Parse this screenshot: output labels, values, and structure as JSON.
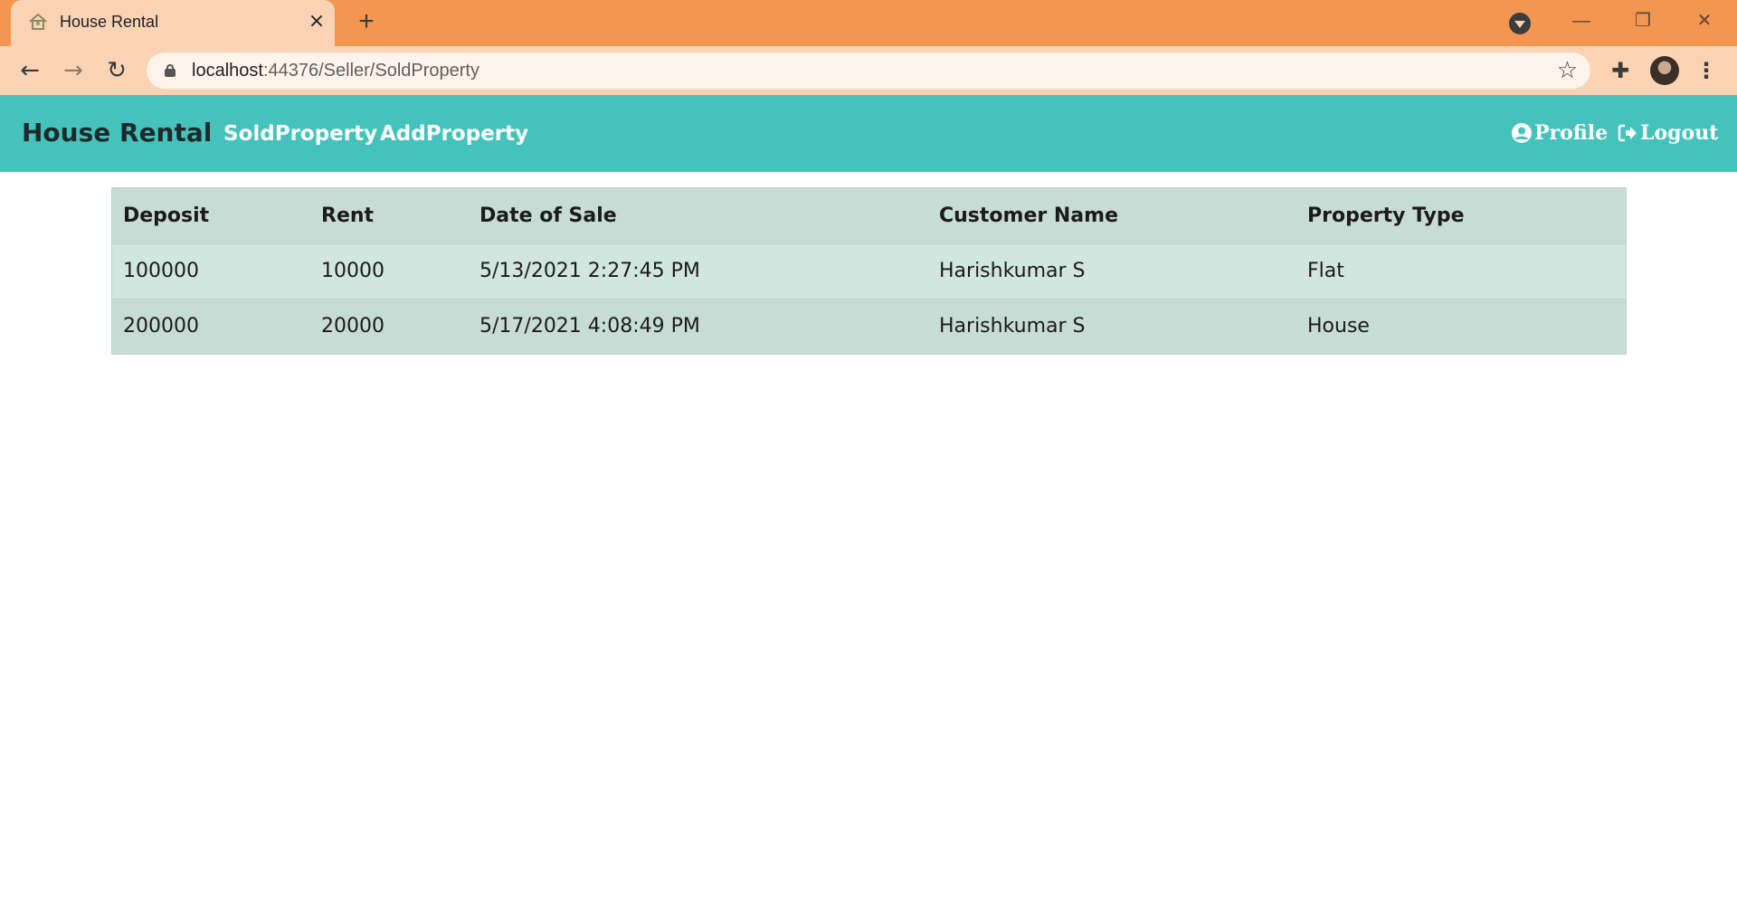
{
  "browser": {
    "tab_title": "House Rental",
    "tab_close": "×",
    "new_tab": "+",
    "url_host": "localhost",
    "url_path": ":44376/Seller/SoldProperty",
    "icons": [
      "back-arrow-icon",
      "forward-arrow-icon",
      "reload-icon",
      "lock-icon",
      "star-icon",
      "extensions-icon",
      "menu-dots-icon"
    ]
  },
  "navbar": {
    "brand": "House Rental",
    "links": [
      "SoldProperty",
      "AddProperty"
    ],
    "profile": "Profile",
    "logout": "Logout",
    "bg_color": "#45c2bb"
  },
  "table": {
    "headers": [
      "Deposit",
      "Rent",
      "Date of Sale",
      "Customer Name",
      "Property Type"
    ],
    "rows": [
      [
        "100000",
        "10000",
        "5/13/2021 2:27:45 PM",
        "Harishkumar S",
        "Flat"
      ],
      [
        "200000",
        "20000",
        "5/17/2021 4:08:49 PM",
        "Harishkumar S",
        "House"
      ]
    ]
  }
}
